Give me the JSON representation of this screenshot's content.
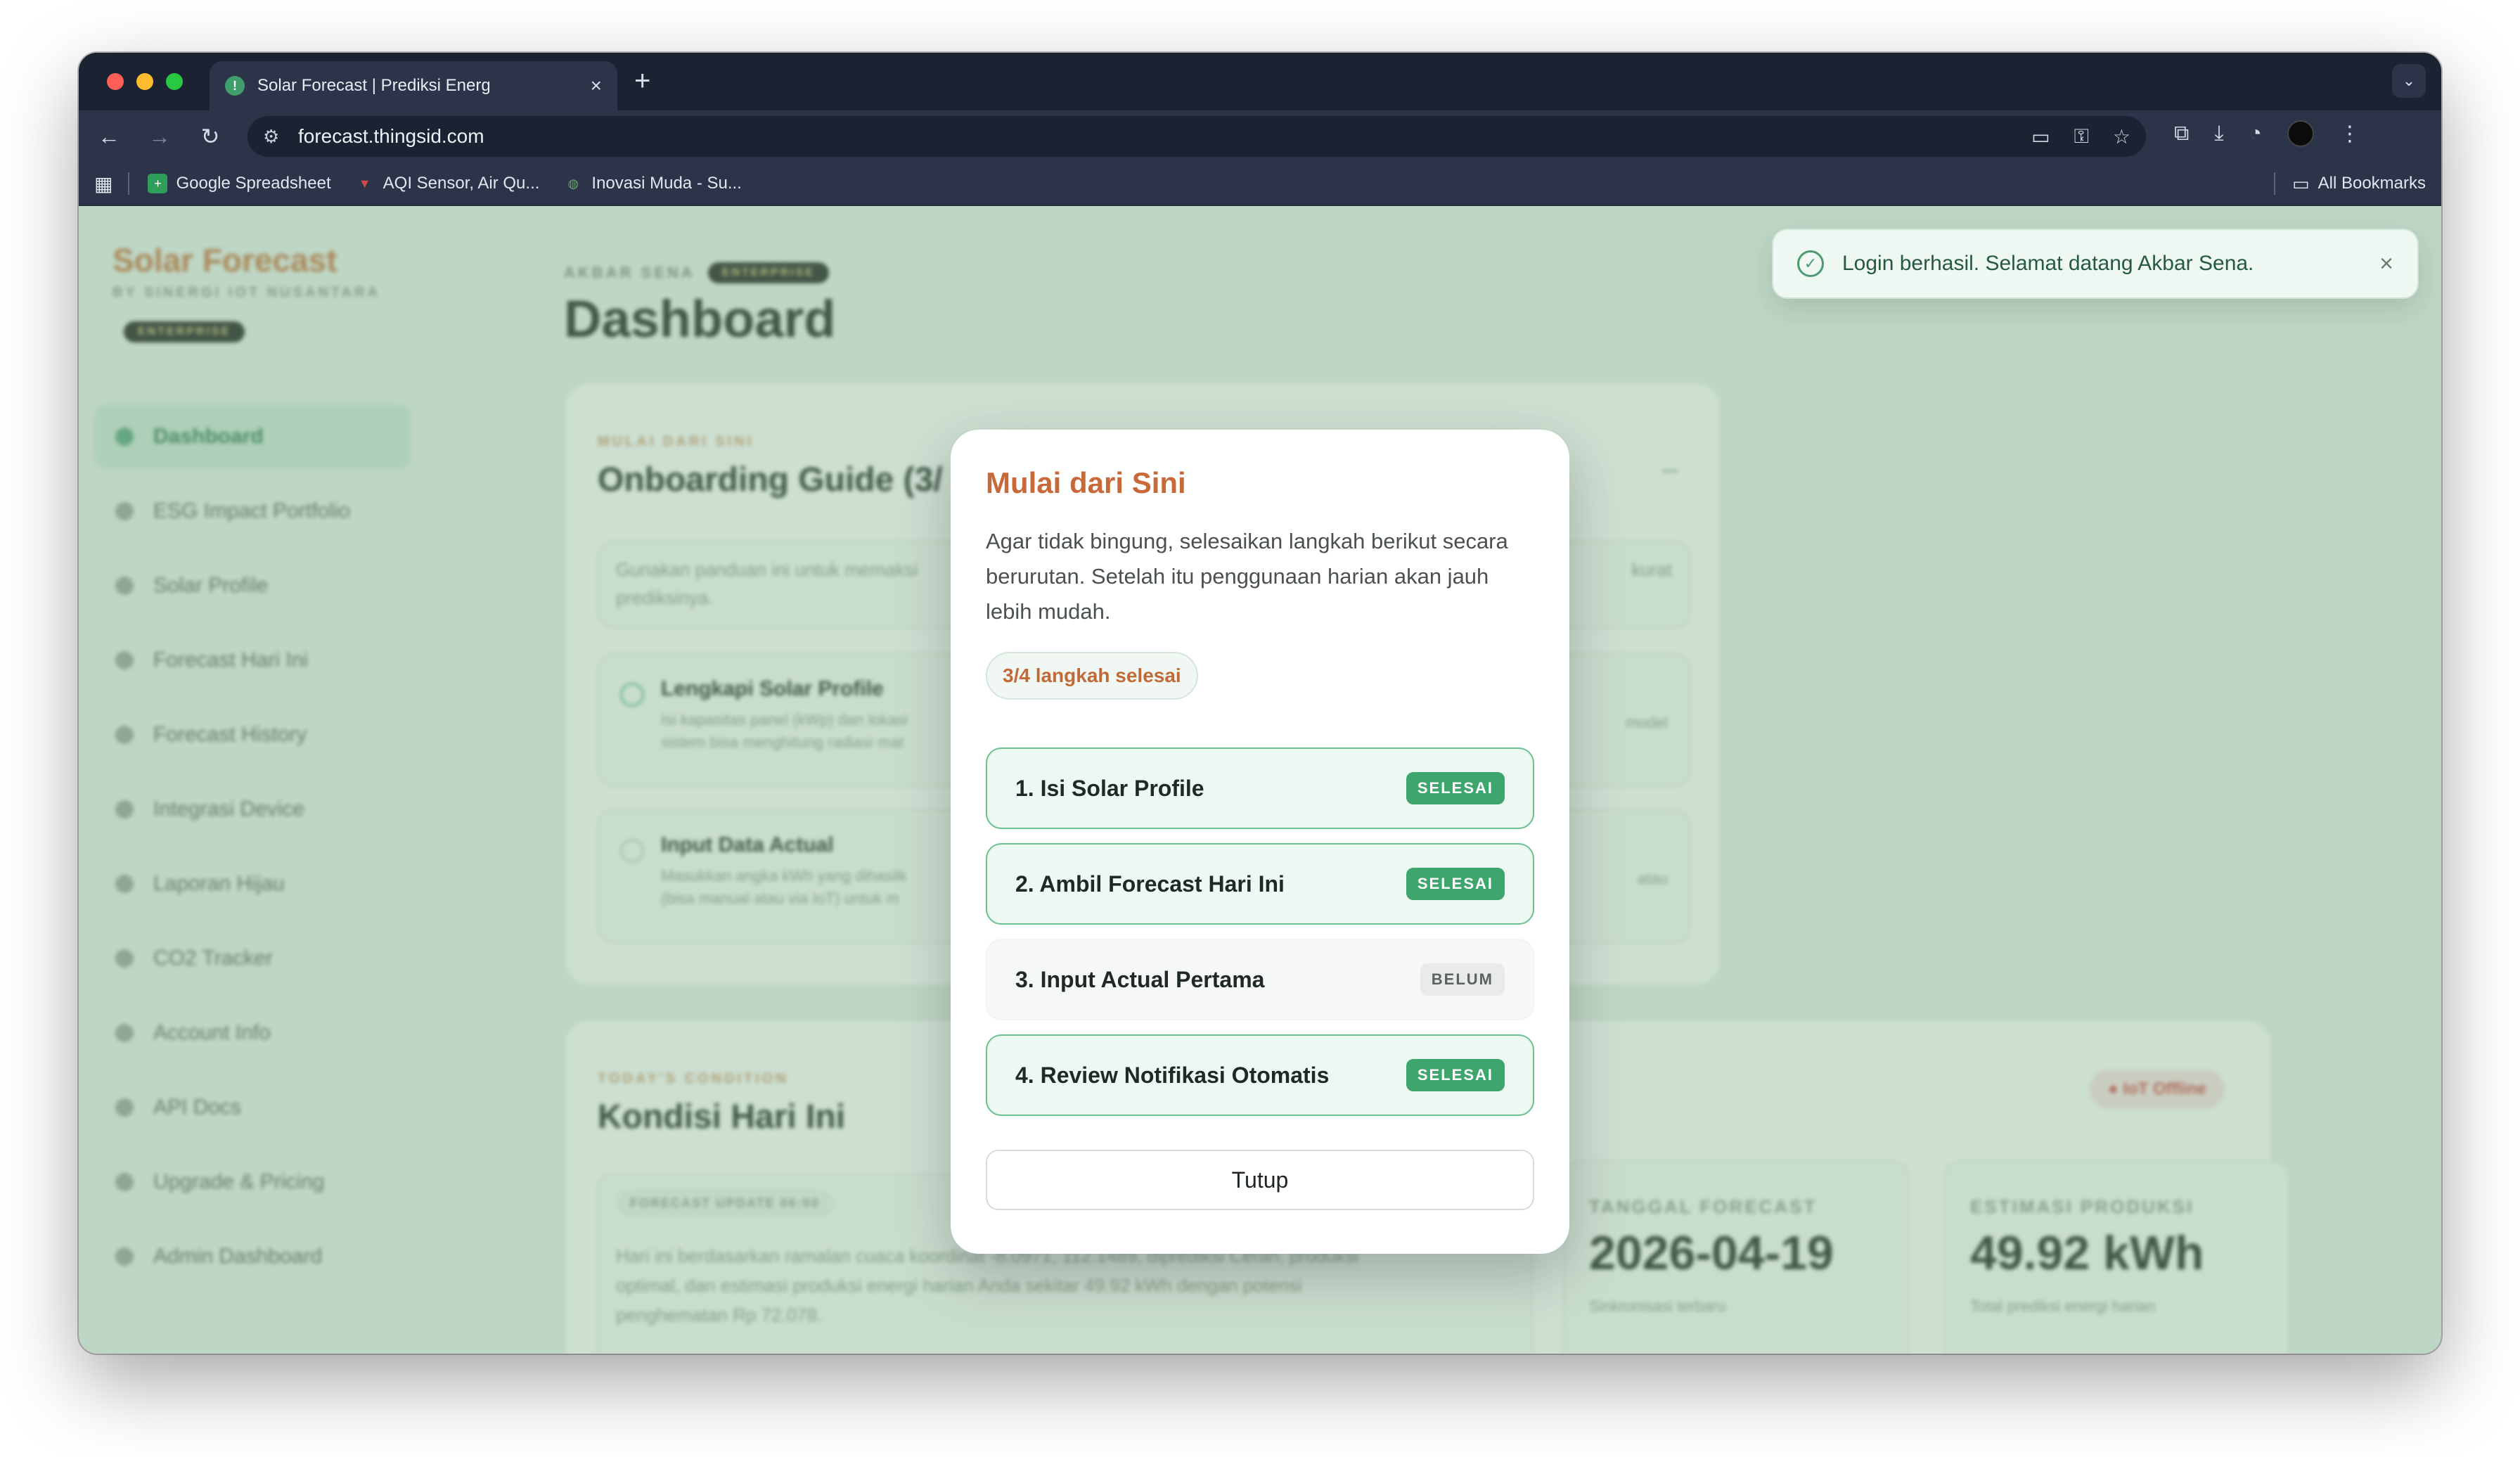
{
  "browser": {
    "tab_title": "Solar Forecast | Prediksi Energi",
    "url": "forecast.thingsid.com",
    "bookmarks": [
      {
        "label": "Google Spreadsheet",
        "color": "#2f9e5b"
      },
      {
        "label": "AQI Sensor, Air Qu...",
        "color": "#d04848"
      },
      {
        "label": "Inovasi Muda - Su...",
        "color": "#6aa36f"
      }
    ],
    "all_bookmarks": "All Bookmarks"
  },
  "sidebar": {
    "brand": "Solar Forecast",
    "brand_sub": "BY SINERGI IOT NUSANTARA",
    "plan": "ENTERPRISE",
    "items": [
      {
        "label": "Dashboard"
      },
      {
        "label": "ESG Impact Portfolio"
      },
      {
        "label": "Solar Profile"
      },
      {
        "label": "Forecast Hari Ini"
      },
      {
        "label": "Forecast History"
      },
      {
        "label": "Integrasi Device"
      },
      {
        "label": "Laporan Hijau"
      },
      {
        "label": "CO2 Tracker"
      },
      {
        "label": "Account Info"
      },
      {
        "label": "API Docs"
      },
      {
        "label": "Upgrade & Pricing"
      },
      {
        "label": "Admin Dashboard"
      }
    ]
  },
  "main": {
    "user_name": "AKBAR SENA",
    "plan": "ENTERPRISE",
    "title": "Dashboard",
    "onboarding": {
      "eyebrow": "MULAI DARI SINI",
      "title": "Onboarding Guide (3/",
      "intro": "Gunakan panduan ini untuk memaksi",
      "intro2": "prediksinya.",
      "right_text": "kurat",
      "item1_title": "Lengkapi Solar Profile",
      "item1_desc": "Isi kapasitas panel (kWp) dan lokasi",
      "item1_desc2": "sistem bisa menghitung radiasi mat",
      "item1_right": "model",
      "item2_title": "Input Data Actual",
      "item2_desc": "Masukkan angka kWh yang dihasilk",
      "item2_desc2": "(bisa manual atau via IoT) untuk m",
      "item2_right": "atau"
    },
    "today": {
      "eyebrow": "TODAY'S CONDITION",
      "title": "Kondisi Hari Ini",
      "iot_status": "IoT Offline",
      "update_badge": "FORECAST UPDATE 06:00",
      "summary1": "Hari ini berdasarkan ramalan cuaca koordinat -8.0971, 112.1489, diprediksi Cerah, produksi",
      "summary2": "optimal, dan estimasi produksi energi harian Anda sekitar 49.92 kWh dengan potensi",
      "summary3": "penghematan Rp 72.078.",
      "forecast_date_label": "TANGGAL FORECAST",
      "forecast_date": "2026-04-19",
      "forecast_date_sub": "Sinkronisasi terbaru",
      "production_label": "ESTIMASI PRODUKSI",
      "production_value": "49.92 kWh",
      "production_sub": "Total prediksi energi harian"
    }
  },
  "toast": {
    "message": "Login berhasil. Selamat datang Akbar Sena.",
    "close": "×"
  },
  "modal": {
    "title": "Mulai dari Sini",
    "description": "Agar tidak bingung, selesaikan langkah berikut secara berurutan. Setelah itu penggunaan harian akan jauh lebih mudah.",
    "progress": "3/4 langkah selesai",
    "steps": [
      {
        "label": "1. Isi Solar Profile",
        "status": "SELESAI",
        "done": true
      },
      {
        "label": "2. Ambil Forecast Hari Ini",
        "status": "SELESAI",
        "done": true
      },
      {
        "label": "3. Input Actual Pertama",
        "status": "BELUM",
        "done": false
      },
      {
        "label": "4. Review Notifikasi Otomatis",
        "status": "SELESAI",
        "done": true
      }
    ],
    "close_label": "Tutup"
  },
  "colors": {
    "accent_orange": "#c8693a",
    "success_green": "#3ea56c",
    "overlay_tint": "#78aa87"
  }
}
